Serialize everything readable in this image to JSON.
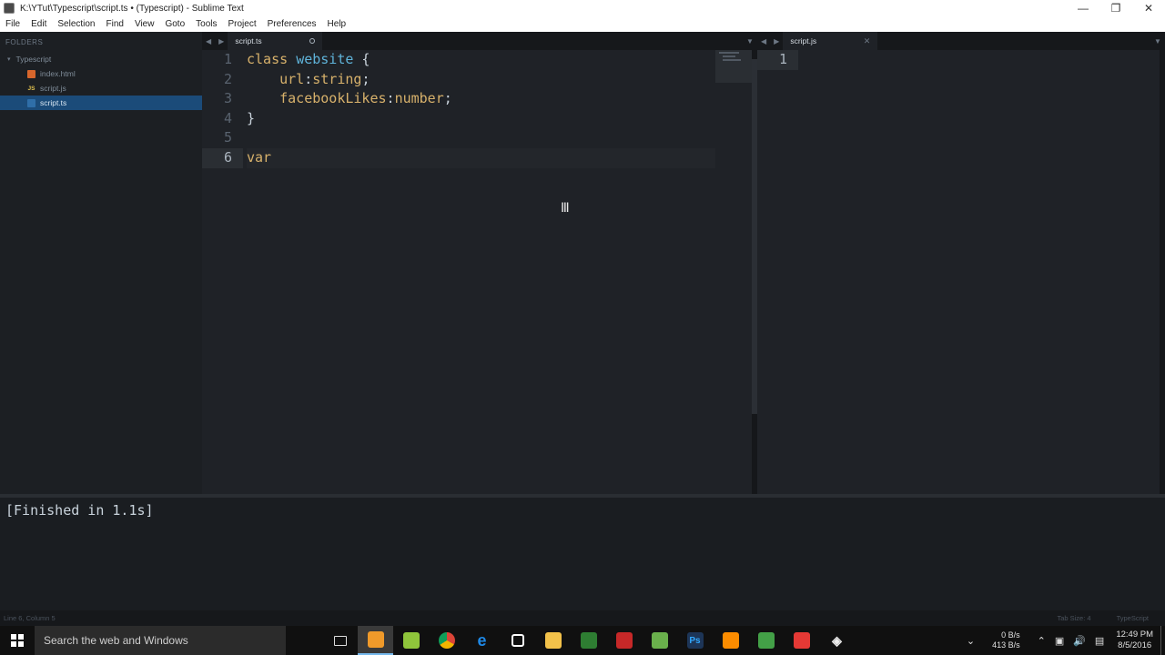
{
  "window": {
    "title": "K:\\YTut\\Typescript\\script.ts • (Typescript) - Sublime Text",
    "controls": [
      "minimize-icon",
      "restore-icon",
      "close-icon"
    ]
  },
  "menu": [
    "File",
    "Edit",
    "Selection",
    "Find",
    "View",
    "Goto",
    "Tools",
    "Project",
    "Preferences",
    "Help"
  ],
  "sidebar": {
    "header": "FOLDERS",
    "folder": "Typescript",
    "files": [
      {
        "name": "index.html",
        "icon": "html-file-icon"
      },
      {
        "name": "script.js",
        "icon": "js-file-icon"
      },
      {
        "name": "script.ts",
        "icon": "ts-file-icon",
        "selected": true
      }
    ]
  },
  "tabs": {
    "left": {
      "label": "script.ts",
      "modified": true
    },
    "right": {
      "label": "script.js"
    }
  },
  "editor_left": {
    "line_numbers": [
      "1",
      "2",
      "3",
      "4",
      "5",
      "6"
    ],
    "active_line": 6,
    "code": {
      "l1_kw": "class",
      "l1_name": "website",
      "l1_punc": " {",
      "l2_prop": "url",
      "l2_colon": ":",
      "l2_type": "string",
      "l2_end": ";",
      "l3_prop": "facebookLikes",
      "l3_colon": ":",
      "l3_type": "number",
      "l3_end": ";",
      "l4": "}",
      "l6_kw": "var"
    }
  },
  "editor_right": {
    "line_numbers": [
      "1"
    ]
  },
  "output": {
    "text": "[Finished in 1.1s]"
  },
  "statusbar": {
    "position": "Line 6, Column 5",
    "tab_size": "Tab Size: 4",
    "syntax": "TypeScript"
  },
  "taskbar": {
    "search_placeholder": "Search the web and Windows",
    "apps": [
      {
        "name": "task-view-icon",
        "color": "#101010"
      },
      {
        "name": "sublime-text-icon",
        "color": "#f09a2a",
        "active": true
      },
      {
        "name": "notepad-plus-plus-icon",
        "color": "#8fc53b"
      },
      {
        "name": "chrome-icon",
        "color": "#dd4b39"
      },
      {
        "name": "edge-icon",
        "color": "#1e88e5"
      },
      {
        "name": "store-icon",
        "color": "#ffffff"
      },
      {
        "name": "file-explorer-icon",
        "color": "#f2c14a"
      },
      {
        "name": "xampp-icon",
        "color": "#2e7d32"
      },
      {
        "name": "filezilla-icon",
        "color": "#c62828"
      },
      {
        "name": "app-tile-icon",
        "color": "#6ab04c"
      },
      {
        "name": "photoshop-icon",
        "color": "#1d3557"
      },
      {
        "name": "xampp-control-icon",
        "color": "#fb8c00"
      },
      {
        "name": "utorrent-icon",
        "color": "#43a047"
      },
      {
        "name": "app-red-icon",
        "color": "#e53935"
      },
      {
        "name": "unity-icon",
        "color": "#222222"
      }
    ],
    "net_up": "0 B/s",
    "net_down": "413 B/s",
    "time": "12:49 PM",
    "date": "8/5/2016"
  }
}
